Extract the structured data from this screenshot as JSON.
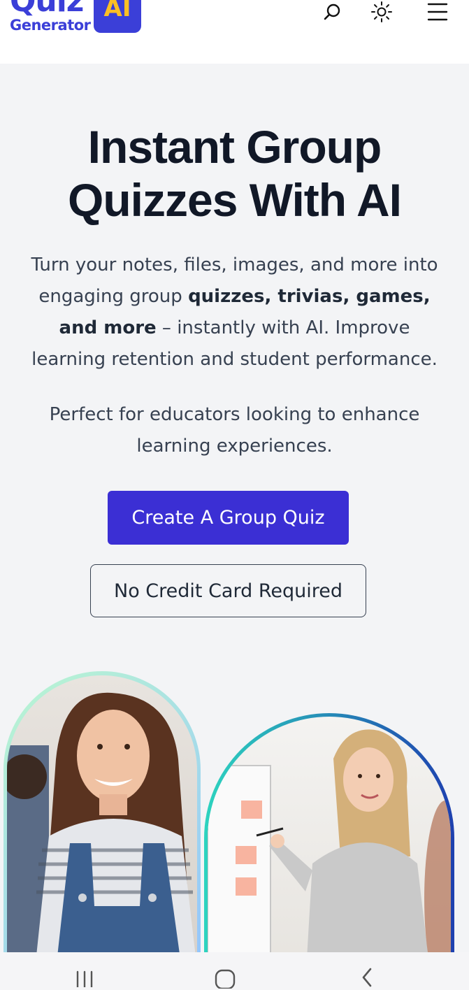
{
  "header": {
    "logo_quiz": "Quiz",
    "logo_generator": "Generator",
    "logo_ai": "AI",
    "icons": [
      "search-icon",
      "sun-icon",
      "menu-icon"
    ]
  },
  "hero": {
    "title_line1": "Instant Group",
    "title_line2": "Quizzes With AI",
    "desc_part1": "Turn your notes, files, images, and more into engaging group ",
    "desc_bold": "quizzes, trivias, games, and more",
    "desc_part2": " – instantly with AI. Improve learning retention and student performance.",
    "subtext": "Perfect for educators looking to enhance learning experiences.",
    "cta_label": "Create A Group Quiz",
    "badge_label": "No Credit Card Required"
  },
  "colors": {
    "brand": "#3b3fd8",
    "accent_yellow": "#fbbf24",
    "cta": "#3b2fd4",
    "background": "#f3f4f6"
  },
  "system_nav": {
    "icons": [
      "recent-apps-icon",
      "home-icon",
      "back-icon"
    ]
  }
}
